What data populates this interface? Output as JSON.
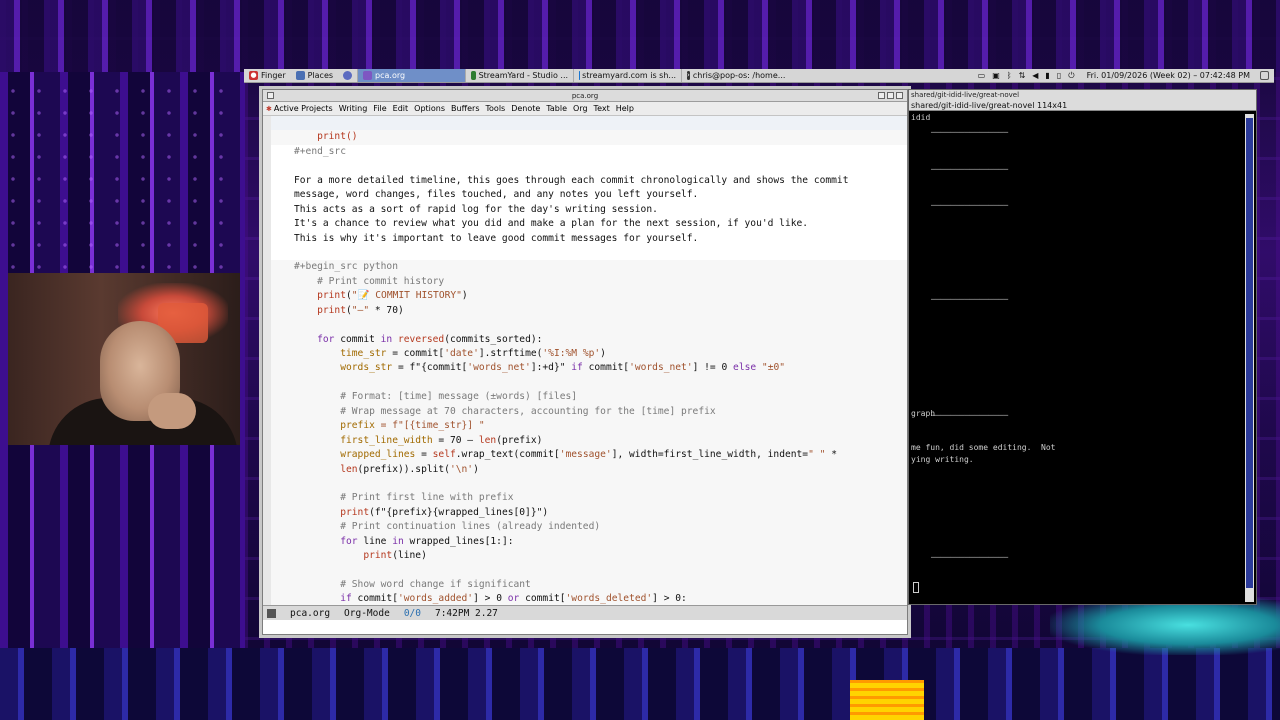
{
  "panel": {
    "menus": [
      "Finger",
      "Places"
    ],
    "tasks": [
      {
        "label": "pca.org",
        "active": true
      },
      {
        "label": "StreamYard - Studio ...",
        "active": false
      },
      {
        "label": "streamyard.com is sh...",
        "active": false
      },
      {
        "label": "chris@pop-os: /home...",
        "active": false
      }
    ],
    "clock": "Fri. 01/09/2026 (Week 02) – 07:42:48 PM"
  },
  "emacs": {
    "title": "pca.org",
    "menu": [
      "Active Projects",
      "Writing",
      "File",
      "Edit",
      "Options",
      "Buffers",
      "Tools",
      "Denote",
      "Table",
      "Org",
      "Text",
      "Help"
    ],
    "mode_line": {
      "buffer": "pca.org",
      "mode": "Org-Mode",
      "position": "0/0",
      "time_load": "7:42PM 2.27"
    }
  },
  "code": {
    "l1": "print()",
    "l2": "#+end_src",
    "p1": "For a more detailed timeline, this goes through each commit chronologically and shows the commit",
    "p2": "message, word changes, files touched, and any notes you left yourself.",
    "p3": "This acts as a sort of rapid log for the day's writing session.",
    "p4": "It's a chance to review what you did and make a plan for the next session, if you'd like.",
    "p5": "This is why it's important to leave good commit messages for yourself.",
    "begin": "#+begin_src python",
    "c1": "# Print commit history",
    "c2_fn": "print",
    "c2_str": "\"📝 COMMIT HISTORY\"",
    "c3_fn": "print",
    "c3_str": "\"–\"",
    "c3_rest": " * 70)",
    "f1_kw": "for",
    "f1_a": " commit ",
    "f1_in": "in",
    "f1_fn": " reversed",
    "f1_b": "(commits_sorted):",
    "t1_var": "time_str",
    "t1_a": " = commit[",
    "t1_s1": "'date'",
    "t1_b": "].strftime(",
    "t1_s2": "'%I:%M %p'",
    "t1_c": ")",
    "w1_var": "words_str",
    "w1_a": " = f\"{commit[",
    "w1_s1": "'words_net'",
    "w1_b": "]:+d}\" ",
    "w1_if": "if",
    "w1_c": " commit[",
    "w1_s2": "'words_net'",
    "w1_d": "] != 0 ",
    "w1_else": "else",
    "w1_s3": " \"±0\"",
    "fm1": "# Format: [time] message (±words) [files]",
    "fm2": "# Wrap message at 70 characters, accounting for the [time] prefix",
    "pr_var": "prefix",
    "pr_a": " = f\"[{time_str}] \"",
    "fl_var": "first_line_width",
    "fl_a": " = 70 – ",
    "fl_fn": "len",
    "fl_b": "(prefix)",
    "wl_var": "wrapped_lines",
    "wl_a": " = ",
    "wl_self": "self",
    "wl_b": ".wrap_text(commit[",
    "wl_s1": "'message'",
    "wl_c": "], width=first_line_width, indent=",
    "wl_s2": "\" \"",
    "wl_d": " *",
    "wl2_fn": "len",
    "wl2_a": "(prefix)).split(",
    "wl2_s": "'\\n'",
    "wl2_b": ")",
    "pf_cm": "# Print first line with prefix",
    "pf_fn": "print",
    "pf_a": "(f\"{prefix}{wrapped_lines[0]}\")",
    "pc_cm": "# Print continuation lines (already indented)",
    "fo_kw": "for",
    "fo_a": " line ",
    "fo_in": "in",
    "fo_b": " wrapped_lines[1:]:",
    "pl_fn": "print",
    "pl_a": "(line)",
    "sw_cm": "# Show word change if significant",
    "if_kw": "if",
    "if_a": " commit[",
    "if_s1": "'words_added'",
    "if_b": "] > 0 ",
    "if_or": "or",
    "if_c": " commit[",
    "if_s2": "'words_deleted'",
    "if_d": "] > 0:"
  },
  "terminal": {
    "title_bar": "shared/git-idid-live/great-novel",
    "title": "shared/git-idid-live/great-novel 114x41",
    "lines": [
      "idid",
      "graph",
      "me fun, did some editing.  Not",
      "ying writing."
    ]
  },
  "colors": {
    "keyword": "#7a2fa8",
    "builtin": "#b5391f",
    "string": "#a0522d",
    "comment": "#7a7a7a",
    "variable": "#a16a00"
  }
}
